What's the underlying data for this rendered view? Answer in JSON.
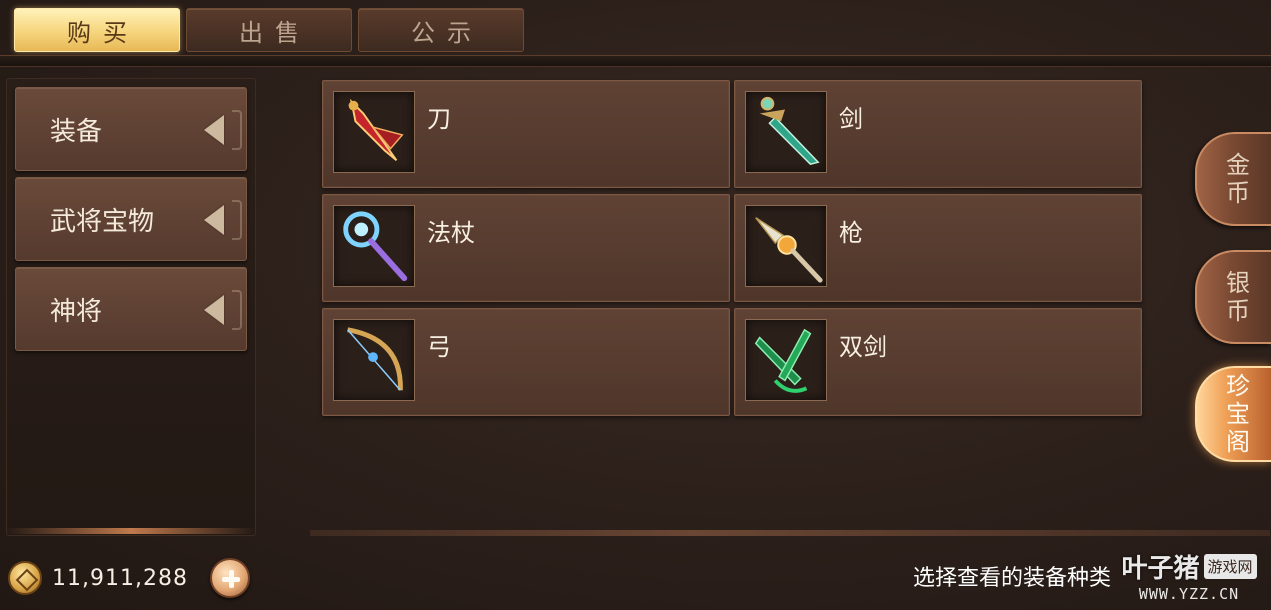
{
  "tabs": [
    {
      "label": "购买",
      "active": true
    },
    {
      "label": "出售",
      "active": false
    },
    {
      "label": "公示",
      "active": false
    }
  ],
  "categories": [
    {
      "label": "装备"
    },
    {
      "label": "武将宝物"
    },
    {
      "label": "神将"
    }
  ],
  "items": [
    {
      "label": "刀",
      "icon": "blade-icon"
    },
    {
      "label": "剑",
      "icon": "sword-icon"
    },
    {
      "label": "法杖",
      "icon": "staff-icon"
    },
    {
      "label": "枪",
      "icon": "spear-icon"
    },
    {
      "label": "弓",
      "icon": "bow-icon"
    },
    {
      "label": "双剑",
      "icon": "twin-swords-icon"
    }
  ],
  "side_tabs": [
    {
      "label": "金币",
      "chars": [
        "金",
        "币"
      ],
      "active": false
    },
    {
      "label": "银币",
      "chars": [
        "银",
        "币"
      ],
      "active": false
    },
    {
      "label": "珍宝阁",
      "chars": [
        "珍",
        "宝",
        "阁"
      ],
      "active": true
    }
  ],
  "currency": {
    "amount": "11,911,288",
    "icon": "coin-icon"
  },
  "hint": "选择查看的装备种类",
  "watermark": {
    "text": "叶子猪",
    "badge": "游戏网",
    "url": "WWW.YZZ.CN"
  },
  "colors": {
    "active_tab": "#f6d57d",
    "panel": "#5f4234",
    "accent": "#ef9f55"
  }
}
